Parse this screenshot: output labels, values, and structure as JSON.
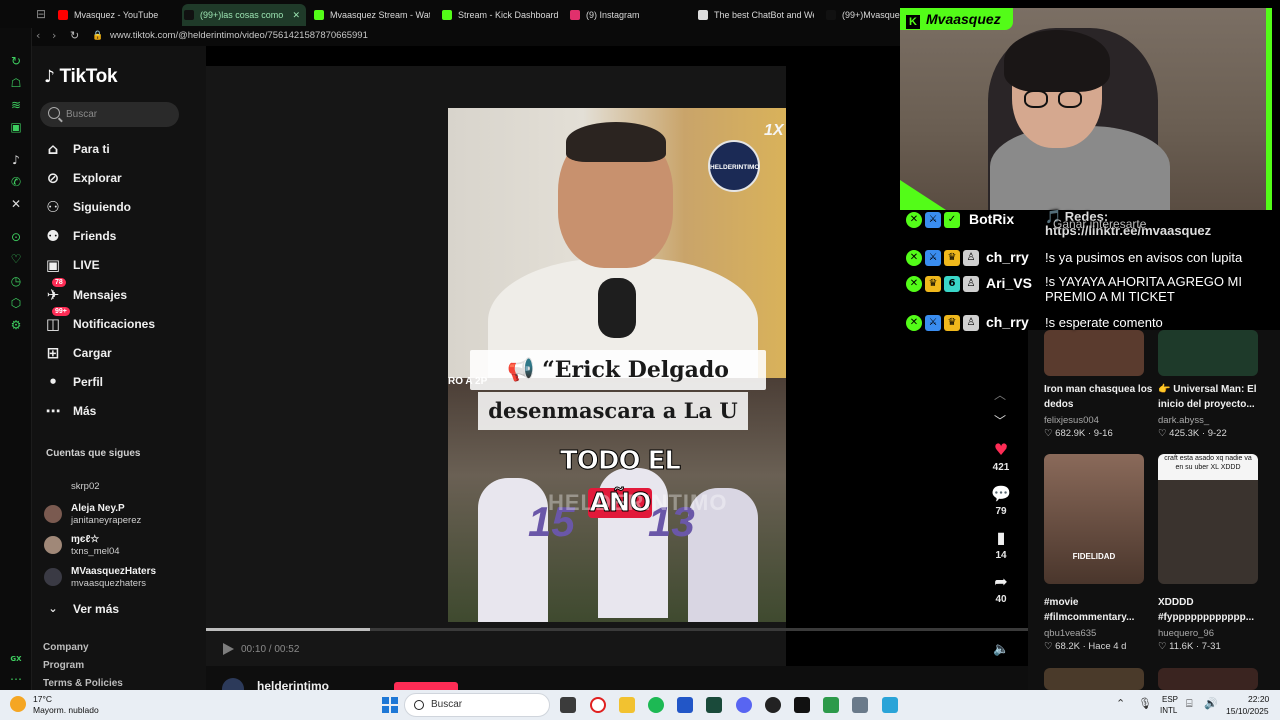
{
  "browser": {
    "tabs": [
      {
        "label": "Mvasquez - YouTube",
        "favicon_color": "#ff0000"
      },
      {
        "label": "(99+)las cosas como",
        "favicon_color": "#111111"
      },
      {
        "label": "Mvaasquez Stream - Watch",
        "favicon_color": "#53fc18"
      },
      {
        "label": "Stream - Kick Dashboard",
        "favicon_color": "#53fc18"
      },
      {
        "label": "(9) Instagram",
        "favicon_color": "#e1306c"
      },
      {
        "label": "The best ChatBot and We",
        "favicon_color": "#dddddd"
      },
      {
        "label": "(99+)Mvasquez",
        "favicon_color": "#111111"
      }
    ],
    "url": "www.tiktok.com/@helderintimo/video/7561421587870665991"
  },
  "sidebar": {
    "logo": "TikTok",
    "search_placeholder": "Buscar",
    "nav": [
      {
        "label": "Para ti",
        "icon": "home-icon",
        "glyph": "⌂"
      },
      {
        "label": "Explorar",
        "icon": "compass-icon",
        "glyph": "⊘"
      },
      {
        "label": "Siguiendo",
        "icon": "following-icon",
        "glyph": "⚇"
      },
      {
        "label": "Friends",
        "icon": "friends-icon",
        "glyph": "⚉"
      },
      {
        "label": "LIVE",
        "icon": "live-icon",
        "glyph": "▣"
      },
      {
        "label": "Mensajes",
        "icon": "messages-icon",
        "glyph": "✈",
        "badge": "78"
      },
      {
        "label": "Notificaciones",
        "icon": "notifications-icon",
        "glyph": "◫",
        "badge": "99+"
      },
      {
        "label": "Cargar",
        "icon": "upload-icon",
        "glyph": "⊞"
      },
      {
        "label": "Perfil",
        "icon": "profile-icon",
        "glyph": "•"
      },
      {
        "label": "Más",
        "icon": "more-icon",
        "glyph": "⋯"
      }
    ],
    "following_title": "Cuentas que sigues",
    "accounts": [
      {
        "name": "",
        "handle": "skrp02"
      },
      {
        "name": "Aleja Ney.P",
        "handle": "janitaneyraperez"
      },
      {
        "name": "ɱєℓ☆",
        "handle": "txns_mel04"
      },
      {
        "name": "MVaasquezHaters",
        "handle": "mvaasquezhaters"
      }
    ],
    "see_more": "Ver más",
    "footer": [
      "Company",
      "Program",
      "Terms & Policies"
    ]
  },
  "video": {
    "caption_line1": "📢 “Erick Delgado",
    "caption_line2": "desenmascara a La U",
    "caption_line3_a": "TODO EL ",
    "caption_line3_b": "AÑO",
    "side_text": "RO A 2P",
    "watermark": "HELDERINTIMO",
    "logo_text": "HELDERINTIMO",
    "speed": "1X",
    "jersey_left": "15",
    "jersey_right": "13",
    "time": "00:10 / 00:52",
    "progress": 0.2,
    "author": "helderintimo"
  },
  "actions": {
    "likes": "421",
    "comments": "79",
    "saves": "14",
    "shares": "40"
  },
  "recommendations": [
    {
      "title": "Iron man chasquea los dedos",
      "user": "felixjesus004",
      "stats": "♡ 682.9K · 9-16",
      "thumb_color": "#5a3b2e"
    },
    {
      "title": "👉 Universal Man: El inicio del proyecto...",
      "user": "dark.abyss_",
      "stats": "♡ 425.3K · 9-22",
      "thumb_color": "#1e3a2a"
    },
    {
      "title": "#movie #filmcommentary...",
      "user": "qbu1vea635",
      "stats": "♡ 68.2K · Hace 4 d",
      "thumb_color": "#7c5a4a",
      "thumb_text": "FIDELIDAD"
    },
    {
      "title": "XDDDD #fypppppppppppp...",
      "user": "huequero_96",
      "stats": "♡ 11.6K · 7-31",
      "thumb_color": "#2e2a26",
      "thumb_text": "craft esta asado xq nadie va en su uber XL XDDD"
    }
  ],
  "stream": {
    "channel": "Mvaasquez",
    "accent": "#53fc18",
    "chat": [
      {
        "user": "BotRix",
        "message": "🎵 Redes:\nhttps://linktr.ee/mvaasquez",
        "overlap": "Ganar interesarte"
      },
      {
        "user": "ch_rry",
        "message": "!s ya pusimos en avisos con lupita"
      },
      {
        "user": "Ari_VS",
        "message": "!s YAYAYA AHORITA AGREGO MI\nPREMIO A MI TICKET"
      },
      {
        "user": "ch_rry",
        "message": "!s esperate comento"
      }
    ]
  },
  "taskbar": {
    "weather_temp": "17°C",
    "weather_desc": "Mayorm. nublado",
    "search_label": "Buscar",
    "lang_top": "ESP",
    "lang_bottom": "INTL",
    "time": "22:20",
    "date": "15/10/2025"
  }
}
